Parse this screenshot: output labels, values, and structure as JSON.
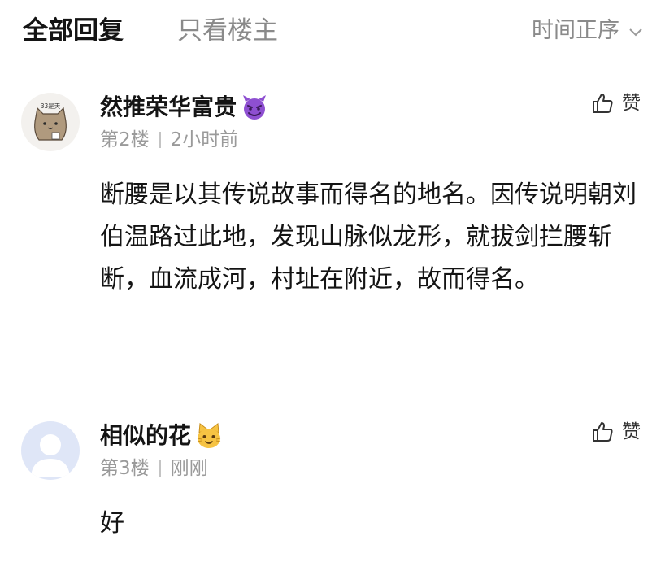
{
  "header": {
    "tab_all": "全部回复",
    "tab_op_only": "只看楼主",
    "sort_label": "时间正序"
  },
  "replies": [
    {
      "username": "然推荣华富贵",
      "avatar_text": "33是天",
      "emoji": "smiling-devil-emoji",
      "floor": "第2楼",
      "time": "2小时前",
      "like_label": "赞",
      "content": "断腰是以其传说故事而得名的地名。因传说明朝刘伯温路过此地，发现山脉似龙形，就拔剑拦腰斩断，血流成河，村址在附近，故而得名。"
    },
    {
      "username": "相似的花",
      "emoji": "cat-face-emoji",
      "floor": "第3楼",
      "time": "刚刚",
      "like_label": "赞",
      "content": "好"
    }
  ],
  "colors": {
    "primary_text": "#141414",
    "secondary_text": "#8a8a8a",
    "devil_purple": "#8e4fd1",
    "cat_yellow": "#f6c343",
    "default_avatar_bg": "#dfe6f7"
  }
}
